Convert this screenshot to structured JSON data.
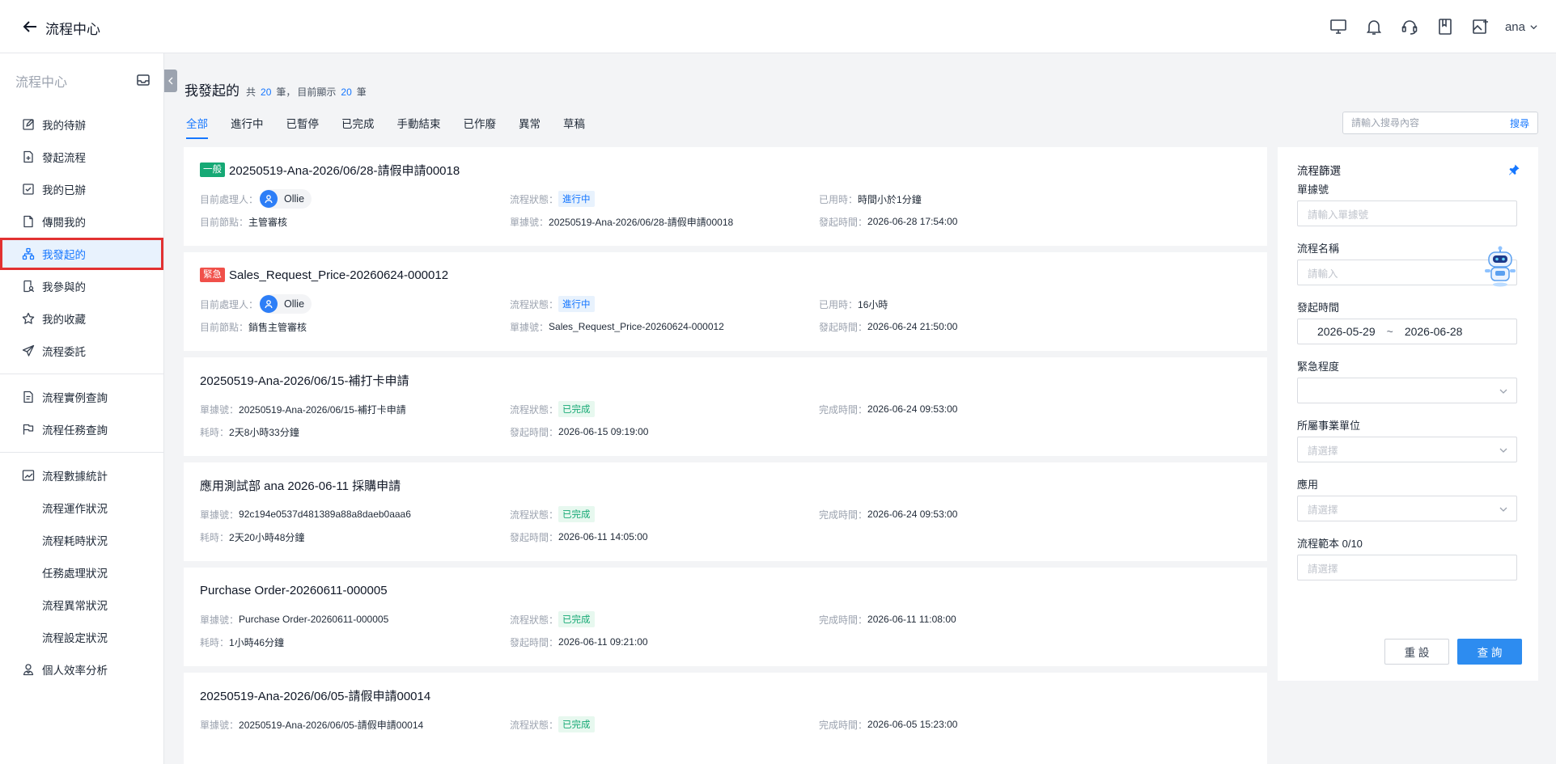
{
  "header": {
    "title": "流程中心",
    "user": "ana"
  },
  "sidebar": {
    "title": "流程中心",
    "groups": [
      [
        {
          "label": "我的待辦",
          "icon": "edit-icon"
        },
        {
          "label": "發起流程",
          "icon": "file-plus-icon"
        },
        {
          "label": "我的已辦",
          "icon": "check-square-icon"
        },
        {
          "label": "傳閱我的",
          "icon": "file-icon"
        },
        {
          "label": "我發起的",
          "icon": "flow-icon",
          "active": true
        },
        {
          "label": "我參與的",
          "icon": "doc-user-icon"
        },
        {
          "label": "我的收藏",
          "icon": "star-icon"
        },
        {
          "label": "流程委託",
          "icon": "send-icon"
        }
      ],
      [
        {
          "label": "流程實例查詢",
          "icon": "doc-search-icon"
        },
        {
          "label": "流程任務查詢",
          "icon": "flag-icon"
        }
      ],
      [
        {
          "label": "流程數據統計",
          "icon": "chart-icon"
        },
        {
          "label": "流程運作狀況",
          "sub": true
        },
        {
          "label": "流程耗時狀況",
          "sub": true
        },
        {
          "label": "任務處理狀況",
          "sub": true
        },
        {
          "label": "流程異常狀況",
          "sub": true
        },
        {
          "label": "流程設定狀況",
          "sub": true
        },
        {
          "label": "個人效率分析",
          "icon": "user-icon"
        }
      ]
    ]
  },
  "page": {
    "title": "我發起的",
    "total_prefix": "共",
    "total": "20",
    "total_unit": "筆，",
    "shown_prefix": "目前顯示",
    "shown": "20",
    "shown_unit": "筆"
  },
  "tabs": [
    "全部",
    "進行中",
    "已暫停",
    "已完成",
    "手動結束",
    "已作廢",
    "異常",
    "草稿"
  ],
  "active_tab": 0,
  "search": {
    "placeholder": "請輸入搜尋內容",
    "button": "搜尋"
  },
  "cards": [
    {
      "tag": "一般",
      "tag_color": "#16a975",
      "title": "20250519-Ana-2026/06/28-請假申請00018",
      "handler_label": "目前處理人：",
      "handler": "Ollie",
      "status_label": "流程狀態：",
      "status": "進行中",
      "status_type": "run",
      "c3a_label": "已用時：",
      "c3a_value": "時間小於1分鐘",
      "c1b_label": "目前節點：",
      "c1b_value": "主管審核",
      "c2b_label": "單據號：",
      "c2b_value": "20250519-Ana-2026/06/28-請假申請00018",
      "c3b_label": "發起時間：",
      "c3b_value": "2026-06-28 17:54:00"
    },
    {
      "tag": "緊急",
      "tag_color": "#f0504a",
      "title": "Sales_Request_Price-20260624-000012",
      "handler_label": "目前處理人：",
      "handler": "Ollie",
      "status_label": "流程狀態：",
      "status": "進行中",
      "status_type": "run",
      "c3a_label": "已用時：",
      "c3a_value": "16小時",
      "c1b_label": "目前節點：",
      "c1b_value": "銷售主管審核",
      "c2b_label": "單據號：",
      "c2b_value": "Sales_Request_Price-20260624-000012",
      "c3b_label": "發起時間：",
      "c3b_value": "2026-06-24 21:50:00"
    },
    {
      "title": "20250519-Ana-2026/06/15-補打卡申請",
      "c1a_label": "單據號：",
      "c1a_value": "20250519-Ana-2026/06/15-補打卡申請",
      "status_label": "流程狀態：",
      "status": "已完成",
      "status_type": "done",
      "c3a_label": "完成時間：",
      "c3a_value": "2026-06-24 09:53:00",
      "c1b_label": "耗時：",
      "c1b_value": "2天8小時33分鐘",
      "c2b_label": "發起時間：",
      "c2b_value": "2026-06-15 09:19:00"
    },
    {
      "title": "應用測試部 ana 2026-06-11 採購申請",
      "c1a_label": "單據號：",
      "c1a_value": "92c194e0537d481389a88a8daeb0aaa6",
      "status_label": "流程狀態：",
      "status": "已完成",
      "status_type": "done",
      "c3a_label": "完成時間：",
      "c3a_value": "2026-06-24 09:53:00",
      "c1b_label": "耗時：",
      "c1b_value": "2天20小時48分鐘",
      "c2b_label": "發起時間：",
      "c2b_value": "2026-06-11 14:05:00"
    },
    {
      "title": "Purchase Order-20260611-000005",
      "c1a_label": "單據號：",
      "c1a_value": "Purchase Order-20260611-000005",
      "status_label": "流程狀態：",
      "status": "已完成",
      "status_type": "done",
      "c3a_label": "完成時間：",
      "c3a_value": "2026-06-11 11:08:00",
      "c1b_label": "耗時：",
      "c1b_value": "1小時46分鐘",
      "c2b_label": "發起時間：",
      "c2b_value": "2026-06-11 09:21:00"
    },
    {
      "title": "20250519-Ana-2026/06/05-請假申請00014",
      "c1a_label": "單據號：",
      "c1a_value": "20250519-Ana-2026/06/05-請假申請00014",
      "status_label": "流程狀態：",
      "status": "已完成",
      "status_type": "done",
      "c3a_label": "完成時間：",
      "c3a_value": "2026-06-05 15:23:00"
    }
  ],
  "filter": {
    "title": "流程篩選",
    "doc_no_label": "單據號",
    "doc_no_placeholder": "請輸入單據號",
    "name_label": "流程名稱",
    "name_placeholder": "請輸入",
    "time_label": "發起時間",
    "time_from": "2026-05-29",
    "time_sep": "~",
    "time_to": "2026-06-28",
    "urgency_label": "緊急程度",
    "unit_label": "所屬事業單位",
    "unit_placeholder": "請選擇",
    "app_label": "應用",
    "app_placeholder": "請選擇",
    "template_label": "流程範本 0/10",
    "template_placeholder": "請選擇",
    "reset": "重 設",
    "query": "查 詢"
  }
}
